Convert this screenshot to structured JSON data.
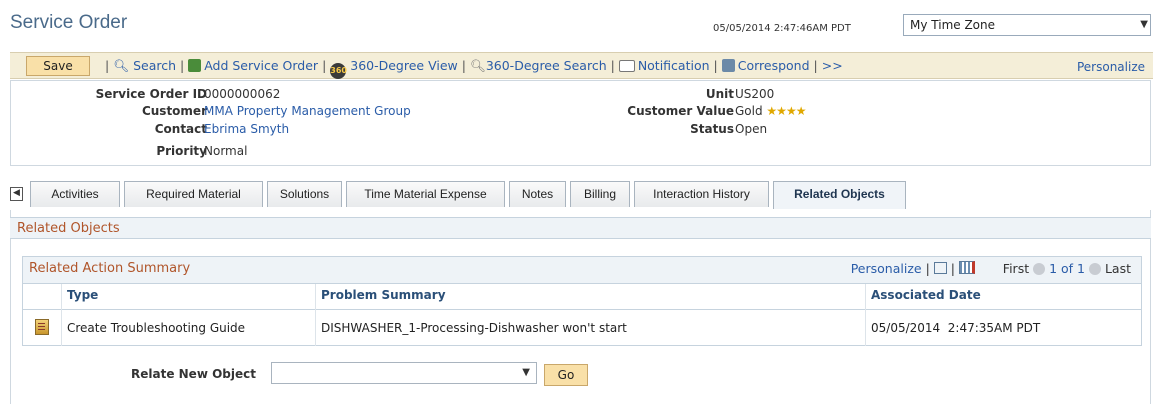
{
  "page": {
    "title": "Service Order",
    "datetime": "05/05/2014 2:47:46AM PDT",
    "timezone": "My Time Zone"
  },
  "toolbar": {
    "save": "Save",
    "search": "Search",
    "add_service_order": "Add Service Order",
    "view_360": "360-Degree View",
    "search_360": "360-Degree Search",
    "notification": "Notification",
    "correspond": "Correspond",
    "more": ">>",
    "personalize": "Personalize",
    "badge_360": "360"
  },
  "summary": {
    "service_order_id_label": "Service Order ID",
    "service_order_id": "0000000062",
    "customer_label": "Customer",
    "customer": "MMA Property Management Group",
    "contact_label": "Contact",
    "contact": "Ebrima Smyth",
    "priority_label": "Priority",
    "priority": "Normal",
    "unit_label": "Unit",
    "unit": "US200",
    "customer_value_label": "Customer Value",
    "customer_value": "Gold",
    "customer_value_stars": 4,
    "status_label": "Status",
    "status": "Open"
  },
  "tabs": [
    {
      "label": "Activities"
    },
    {
      "label": "Required Material"
    },
    {
      "label": "Solutions"
    },
    {
      "label": "Time Material Expense"
    },
    {
      "label": "Notes"
    },
    {
      "label": "Billing"
    },
    {
      "label": "Interaction History"
    },
    {
      "label": "Related Objects"
    }
  ],
  "related_objects": {
    "section_title": "Related Objects",
    "grid": {
      "title": "Related Action Summary",
      "personalize": "Personalize",
      "pager_first": "First",
      "pager_range": "1 of 1",
      "pager_last": "Last",
      "columns": [
        "Type",
        "Problem Summary",
        "Associated Date"
      ],
      "rows": [
        {
          "type": "Create Troubleshooting Guide",
          "problem_summary": "DISHWASHER_1-Processing-Dishwasher won't start",
          "associated_date": "05/05/2014  2:47:35AM PDT"
        }
      ]
    },
    "relate_new_label": "Relate New Object",
    "relate_new_value": "",
    "go": "Go"
  },
  "colors": {
    "link": "#2a5ca8",
    "section_title": "#b0552a",
    "button_bg": "#f9e0a8",
    "star": "#e0a800"
  }
}
